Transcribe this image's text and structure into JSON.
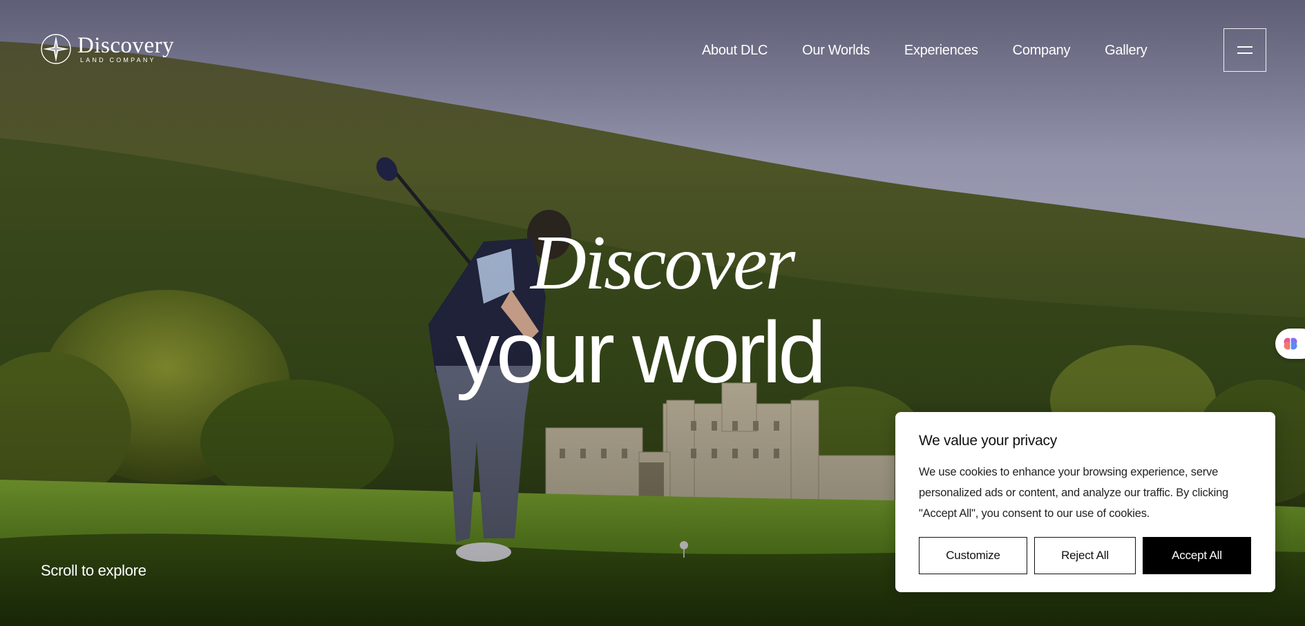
{
  "brand": {
    "name": "Discovery",
    "subtitle": "LAND COMPANY"
  },
  "nav": {
    "items": [
      {
        "label": "About DLC"
      },
      {
        "label": "Our Worlds"
      },
      {
        "label": "Experiences"
      },
      {
        "label": "Company"
      },
      {
        "label": "Gallery"
      }
    ],
    "menu_icon": "hamburger-menu-icon"
  },
  "hero": {
    "line1": "Discover",
    "line2": "your world",
    "scroll_hint": "Scroll to explore"
  },
  "cookie_banner": {
    "title": "We value your privacy",
    "body": "We use cookies to enhance your browsing experience, serve personalized ads or content, and analyze our traffic. By clicking \"Accept All\", you consent to our use of cookies.",
    "buttons": {
      "customize": "Customize",
      "reject": "Reject All",
      "accept": "Accept All"
    }
  },
  "side_widget": {
    "icon": "brain-icon"
  },
  "colors": {
    "text_light": "#ffffff",
    "banner_bg": "#ffffff",
    "accept_bg": "#000000"
  }
}
